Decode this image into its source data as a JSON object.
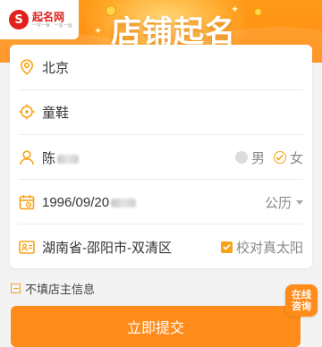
{
  "colors": {
    "accent": "#f7a316",
    "banner": "#ff9018",
    "submit": "#ff8c1a",
    "brand_red": "#e2211c"
  },
  "header": {
    "logo_mark": "S",
    "logo_name": "起名网",
    "logo_tagline": "一字一世 · 一名一运",
    "title": "店铺起名"
  },
  "form": {
    "city": {
      "icon": "location-pin-icon",
      "value": "北京"
    },
    "industry": {
      "icon": "target-icon",
      "value": "童鞋"
    },
    "owner": {
      "icon": "person-icon",
      "surname": "陈",
      "gender_options": [
        {
          "label": "男",
          "selected": false
        },
        {
          "label": "女",
          "selected": true
        }
      ]
    },
    "birth": {
      "icon": "calendar-icon",
      "value": "1996/09/20",
      "calendar_type": "公历"
    },
    "birthplace": {
      "icon": "id-card-icon",
      "value": "湖南省-邵阳市-双清区",
      "checkbox_label": "校对真太阳",
      "checked": true
    }
  },
  "skip_checkbox_label": "不填店主信息",
  "consult_label_line1": "在线",
  "consult_label_line2": "咨询",
  "submit_label": "立即提交"
}
